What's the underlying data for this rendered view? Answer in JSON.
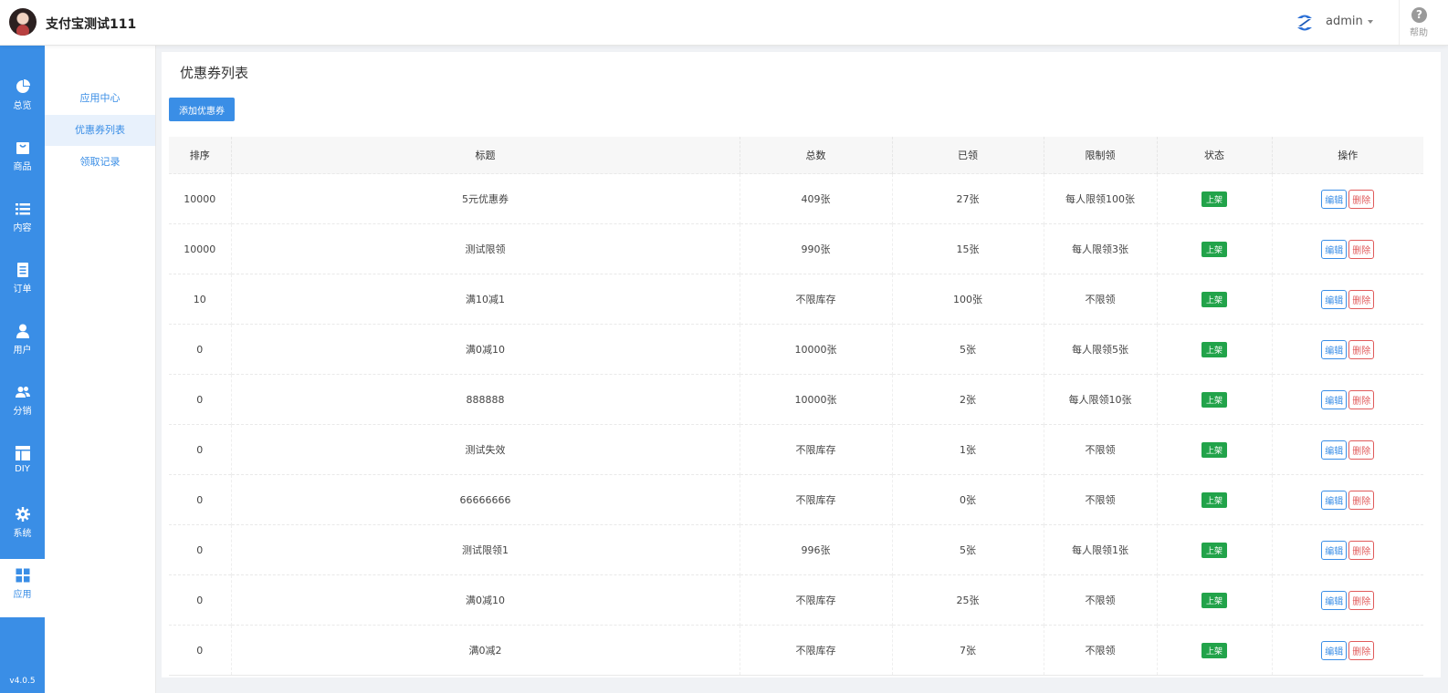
{
  "header": {
    "brand": "支付宝测试111",
    "user": "admin",
    "help": "帮助"
  },
  "sidebar": {
    "items": [
      {
        "label": "总览",
        "icon": "pie-chart-icon"
      },
      {
        "label": "商品",
        "icon": "shopping-bag-icon"
      },
      {
        "label": "内容",
        "icon": "list-icon"
      },
      {
        "label": "订单",
        "icon": "document-icon"
      },
      {
        "label": "用户",
        "icon": "user-icon"
      },
      {
        "label": "分销",
        "icon": "users-icon"
      },
      {
        "label": "DIY",
        "icon": "layout-icon"
      },
      {
        "label": "系统",
        "icon": "gear-icon"
      },
      {
        "label": "应用",
        "icon": "grid-icon"
      }
    ],
    "active": "应用",
    "version": "v4.0.5"
  },
  "subnav": {
    "items": [
      "应用中心",
      "优惠券列表",
      "领取记录"
    ],
    "active": "优惠券列表"
  },
  "main": {
    "title": "优惠券列表",
    "add_button": "添加优惠券",
    "columns": [
      "排序",
      "标题",
      "总数",
      "已领",
      "限制领",
      "状态",
      "操作"
    ],
    "edit_label": "编辑",
    "delete_label": "删除",
    "rows": [
      {
        "sort": "10000",
        "title": "5元优惠券",
        "total": "409张",
        "claimed": "27张",
        "limit": "每人限领100张",
        "status": "上架"
      },
      {
        "sort": "10000",
        "title": "测试限领",
        "total": "990张",
        "claimed": "15张",
        "limit": "每人限领3张",
        "status": "上架"
      },
      {
        "sort": "10",
        "title": "满10减1",
        "total": "不限库存",
        "claimed": "100张",
        "limit": "不限领",
        "status": "上架"
      },
      {
        "sort": "0",
        "title": "满0减10",
        "total": "10000张",
        "claimed": "5张",
        "limit": "每人限领5张",
        "status": "上架"
      },
      {
        "sort": "0",
        "title": "888888",
        "total": "10000张",
        "claimed": "2张",
        "limit": "每人限领10张",
        "status": "上架"
      },
      {
        "sort": "0",
        "title": "测试失效",
        "total": "不限库存",
        "claimed": "1张",
        "limit": "不限领",
        "status": "上架"
      },
      {
        "sort": "0",
        "title": "66666666",
        "total": "不限库存",
        "claimed": "0张",
        "limit": "不限领",
        "status": "上架"
      },
      {
        "sort": "0",
        "title": "测试限领1",
        "total": "996张",
        "claimed": "5张",
        "limit": "每人限领1张",
        "status": "上架"
      },
      {
        "sort": "0",
        "title": "满0减10",
        "total": "不限库存",
        "claimed": "25张",
        "limit": "不限领",
        "status": "上架"
      },
      {
        "sort": "0",
        "title": "满0减2",
        "total": "不限库存",
        "claimed": "7张",
        "limit": "不限领",
        "status": "上架"
      }
    ]
  },
  "colors": {
    "primary": "#3a8ee6",
    "status_green": "#22a34a",
    "danger": "#e05a5a"
  }
}
